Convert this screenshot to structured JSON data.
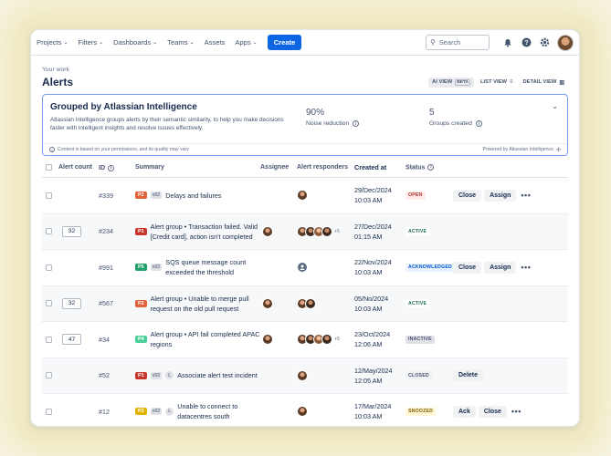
{
  "nav": {
    "items": [
      {
        "label": "Projects",
        "chevron": true
      },
      {
        "label": "Filters",
        "chevron": true
      },
      {
        "label": "Dashboards",
        "chevron": true
      },
      {
        "label": "Teams",
        "chevron": true
      },
      {
        "label": "Assets",
        "chevron": false
      },
      {
        "label": "Apps",
        "chevron": true
      }
    ],
    "create_label": "Create",
    "search_placeholder": "Search"
  },
  "breadcrumb": "Your work",
  "page_title": "Alerts",
  "views": {
    "ai_view": "AI VIEW",
    "ai_badge": "BETA",
    "list_view": "LIST VIEW",
    "detail_view": "DETAIL VIEW"
  },
  "banner": {
    "title": "Grouped by Atlassian Intelligence",
    "description": "Atlassian Intelligence groups alerts by their semantic similarity, to help you make decisions faster with intelligent insights and resolve issues effectively.",
    "stat1_value": "90%",
    "stat1_label": "Noise reduction",
    "stat2_value": "5",
    "stat2_label": "Groups created",
    "footer_note": "Content is based on your permissions, and its quality may vary",
    "powered": "Powered by Atlassian Intelligence"
  },
  "table": {
    "headers": {
      "alert_count": "Alert count",
      "id": "ID",
      "summary": "Summary",
      "assignee": "Assignee",
      "responders": "Alert responders",
      "created": "Created at",
      "status": "Status"
    },
    "rows": [
      {
        "count": "",
        "id": "#339",
        "priority": "P2",
        "prio_color": "#e2623c",
        "tag": "x92",
        "lbadge": false,
        "summary": "Delays and failures",
        "date": "29/Dec/2024",
        "time": "10:03 AM",
        "status": "OPEN",
        "status_color": "#ae2e24",
        "status_bg": "#ffeceb",
        "actions": [
          "Close",
          "Assign"
        ],
        "more": true,
        "has_assignee": false,
        "responders": 1,
        "extra": ""
      },
      {
        "count": "32",
        "id": "#234",
        "priority": "P1",
        "prio_color": "#c9372c",
        "tag": "",
        "lbadge": false,
        "summary": "Alert group • Transaction failed. Valid [Credit card], action isn't completed",
        "date": "27/Dec/2024",
        "time": "01:15 AM",
        "status": "ACTIVE",
        "status_color": "#216e4e",
        "status_bg": "#ffffff",
        "actions": [],
        "more": false,
        "has_assignee": true,
        "responders": 4,
        "extra": "+5"
      },
      {
        "count": "",
        "id": "#991",
        "priority": "P5",
        "prio_color": "#22a06b",
        "tag": "x92",
        "lbadge": false,
        "summary": "SQS queue message count exceeded the threshold",
        "date": "22/Nov/2024",
        "time": "10:03 AM",
        "status": "ACKNOWLEDGED",
        "status_color": "#0055cc",
        "status_bg": "#e9f2ff",
        "actions": [
          "Close",
          "Assign"
        ],
        "more": true,
        "has_assignee": false,
        "responders": 0,
        "extra": ""
      },
      {
        "count": "32",
        "id": "#567",
        "priority": "P2",
        "prio_color": "#e2623c",
        "tag": "",
        "lbadge": false,
        "summary": "Alert group • Unable to merge pull request on the old pull request",
        "date": "05/No/2024",
        "time": "10:03 AM",
        "status": "ACTIVE",
        "status_color": "#216e4e",
        "status_bg": "#ffffff",
        "actions": [],
        "more": false,
        "has_assignee": true,
        "responders": 2,
        "extra": ""
      },
      {
        "count": "47",
        "id": "#34",
        "priority": "P4",
        "prio_color": "#4bce97",
        "tag": "",
        "lbadge": false,
        "summary": "Alert group • API fail completed APAC regions",
        "date": "23/Oct/2024",
        "time": "12:06 AM",
        "status": "INACTIVE",
        "status_color": "#44546f",
        "status_bg": "#dfe1e6",
        "actions": [],
        "more": false,
        "has_assignee": true,
        "responders": 4,
        "extra": "+5"
      },
      {
        "count": "",
        "id": "#52",
        "priority": "P1",
        "prio_color": "#c9372c",
        "tag": "x92",
        "lbadge": true,
        "summary": "Associate alert test incident",
        "date": "12/May/2024",
        "time": "12:05 AM",
        "status": "CLOSED",
        "status_color": "#44546f",
        "status_bg": "#f1f2f4",
        "actions": [
          "Delete"
        ],
        "more": false,
        "has_assignee": false,
        "responders": 1,
        "extra": ""
      },
      {
        "count": "",
        "id": "#12",
        "priority": "P3",
        "prio_color": "#e2b203",
        "tag": "x92",
        "lbadge": true,
        "summary": "Unable to connect to datacentres south",
        "date": "17/Mar/2024",
        "time": "10:03 AM",
        "status": "SNOOZED",
        "status_color": "#7f5f01",
        "status_bg": "#fff7d6",
        "actions": [
          "Ack",
          "Close"
        ],
        "more": true,
        "has_assignee": false,
        "responders": 1,
        "extra": ""
      }
    ]
  }
}
